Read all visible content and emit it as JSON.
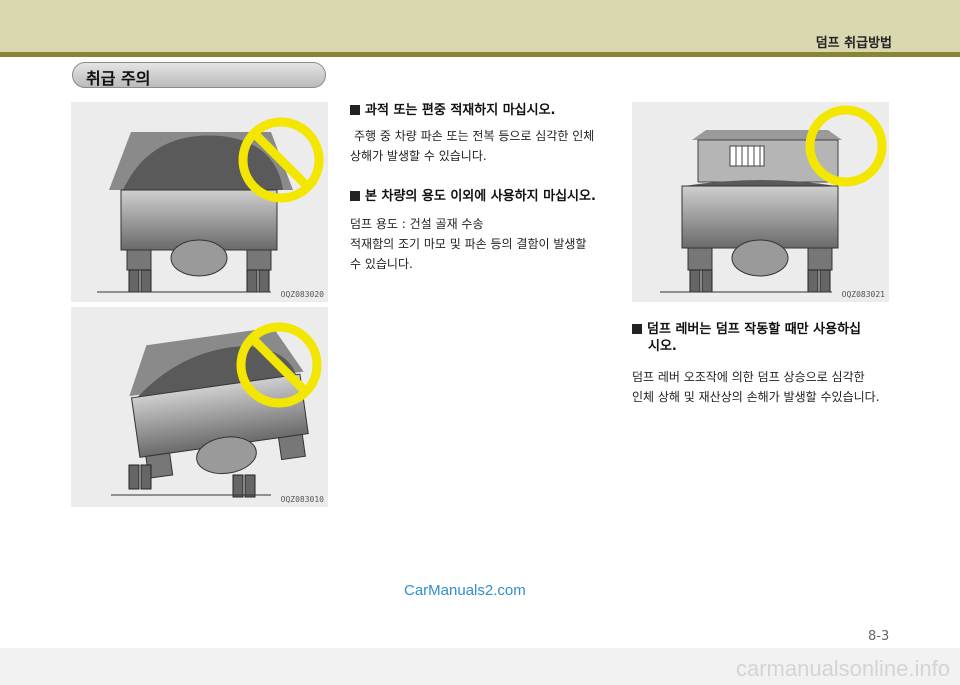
{
  "header": {
    "title": "덤프 취급방법"
  },
  "section": {
    "title": "취급 주의"
  },
  "figures": [
    {
      "code": "OQZ083020",
      "symbol": "prohibited"
    },
    {
      "code": "OQZ083010",
      "symbol": "prohibited"
    },
    {
      "code": "OQZ083021",
      "symbol": "permitted"
    }
  ],
  "notes": [
    {
      "heading": "과적 또는 편중 적재하지 마십시오.",
      "lines": [
        "주행 중 차량 파손 또는 전복 등으로 심각한 인체",
        "상해가 발생할 수 있습니다."
      ]
    },
    {
      "heading": "본 차량의 용도 이외에 사용하지 마십시오.",
      "lines": [
        "덤프 용도 : 건설 골재 수송",
        "적재함의 조기 마모 및 파손 등의 결함이 발생할",
        "수 있습니다."
      ]
    },
    {
      "heading_lines": [
        "덤프 레버는 덤프 작동할 때만 사용하십",
        "시오."
      ],
      "lines": [
        "덤프 레버 오조작에 의한 덤프 상승으로 심각한",
        "인체 상해 및 재산상의 손해가 발생할 수있습니다."
      ]
    }
  ],
  "footer": {
    "watermark": "CarManuals2.com",
    "page_number": "8-3",
    "brand": "carmanualsonline.info"
  },
  "colors": {
    "prohibit_ring": "#f3e600",
    "prohibit_ring_outline": "#e0c800",
    "header_band": "#d9d8b0",
    "header_rule": "#8a8435"
  }
}
